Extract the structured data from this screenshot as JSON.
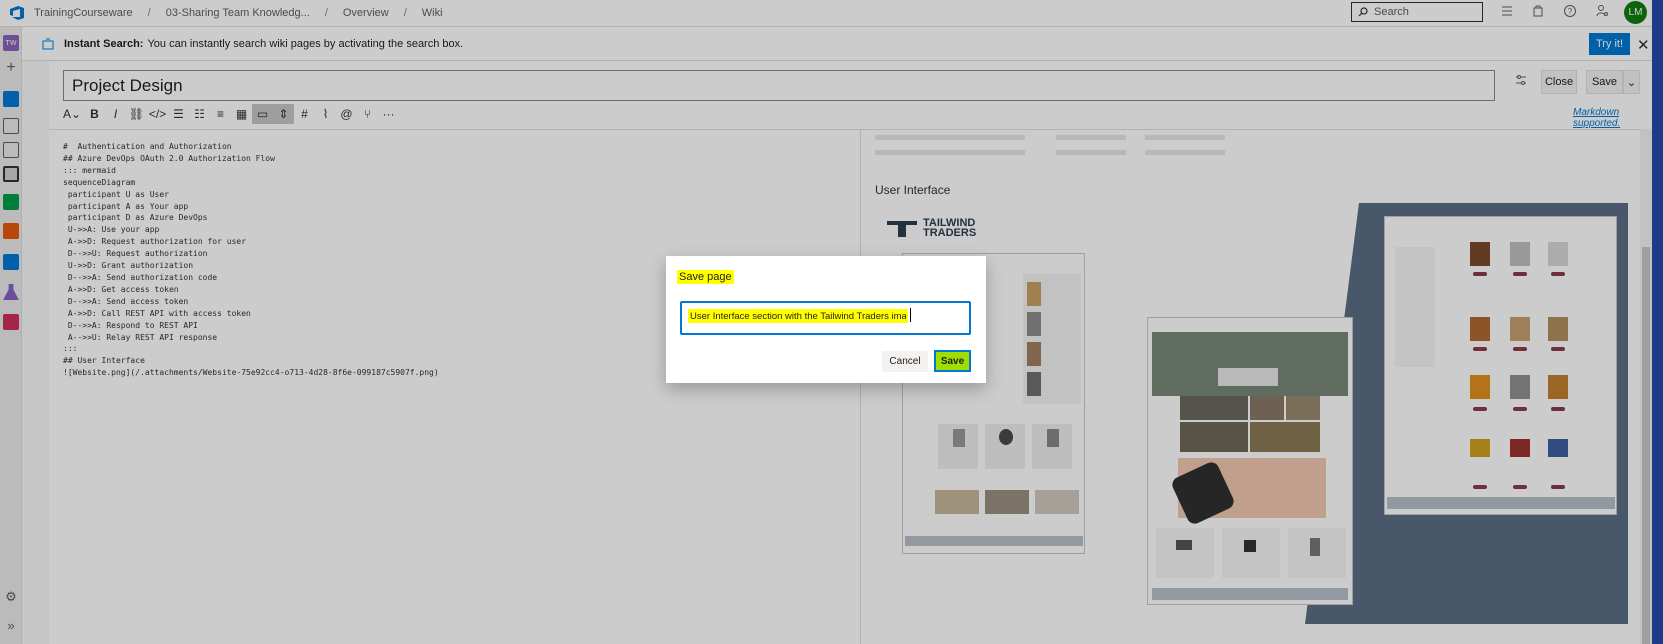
{
  "breadcrumbs": [
    "TrainingCourseware",
    "03-Sharing Team Knowledg...",
    "Overview",
    "Wiki"
  ],
  "search": {
    "placeholder": "Search"
  },
  "user": {
    "initials": "LM"
  },
  "project_badge": "TW",
  "infobar": {
    "title": "Instant Search:",
    "message": "You can instantly search wiki pages by activating the search box.",
    "try_label": "Try it!"
  },
  "page": {
    "title": "Project Design",
    "close_label": "Close",
    "save_label": "Save",
    "markdown_link": "Markdown supported."
  },
  "editor": {
    "lines": [
      "#  Authentication and Authorization",
      "## Azure DevOps OAuth 2.0 Authorization Flow",
      "::: mermaid",
      "sequenceDiagram",
      " participant U as User",
      " participant A as Your app",
      " participant D as Azure DevOps",
      " U->>A: Use your app",
      " A->>D: Request authorization for user",
      " D-->>U: Request authorization",
      " U->>D: Grant authorization",
      " D-->>A: Send authorization code",
      " A->>D: Get access token",
      " D-->>A: Send access token",
      " A->>D: Call REST API with access token",
      " D-->>A: Respond to REST API",
      " A-->>U: Relay REST API response",
      ":::",
      "## User Interface",
      "![Website.png](/.attachments/Website-75e92cc4-o713-4d28-8f6e-099187c5907f.png)"
    ]
  },
  "preview": {
    "heading": "User Interface",
    "logo_line1": "TAILWIND",
    "logo_line2": "TRADERS"
  },
  "dialog": {
    "title": "Save page",
    "comment_value": "User Interface section with the Tailwind Traders image",
    "cancel_label": "Cancel",
    "save_label": "Save"
  }
}
